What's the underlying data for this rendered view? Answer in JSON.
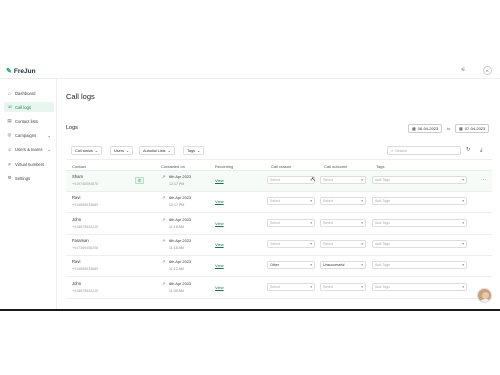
{
  "app": {
    "logo_text": "FreJun",
    "logo_mark": "✎"
  },
  "topbar": {
    "icons": [
      "filter-settings-icon",
      "settings-icon"
    ],
    "avatar_initial": "K"
  },
  "sidebar": {
    "items": [
      {
        "label": "Dashboard",
        "icon": "⌂",
        "active": false
      },
      {
        "label": "Call logs",
        "icon": "☏",
        "active": true
      },
      {
        "label": "Contact lists",
        "icon": "▤",
        "active": false
      },
      {
        "label": "Campaigns",
        "icon": "◎",
        "active": false,
        "has_caret": true
      },
      {
        "label": "Users & teams",
        "icon": "☺",
        "active": false,
        "has_caret": true
      },
      {
        "label": "Virtual numbers",
        "icon": "#",
        "active": false
      },
      {
        "label": "Settings",
        "icon": "⚙",
        "active": false
      }
    ]
  },
  "page": {
    "title": "Call logs",
    "section_title": "Logs"
  },
  "date_range": {
    "start": "06-04-2023",
    "to_label": "to",
    "end": "07-04-2023"
  },
  "filters": [
    {
      "label": "Call status"
    },
    {
      "label": "Users"
    },
    {
      "label": "Autodial Lists"
    },
    {
      "label": "Tags"
    }
  ],
  "search": {
    "placeholder": "Search"
  },
  "table": {
    "headers": [
      "Contact",
      "Contacted on",
      "Recording",
      "Call reason",
      "Call outcome",
      "Tags"
    ],
    "rows": [
      {
        "name": "Sham",
        "phone": "+919748094875",
        "date": "6th Apr 2023",
        "time": "12:17 PM",
        "recording": "View",
        "reason": "Select",
        "reason_filled": false,
        "outcome": "Select",
        "outcome_filled": false,
        "tags": "Add Tags",
        "highlight": true
      },
      {
        "name": "Ravi",
        "phone": "+919896533689",
        "date": "6th Apr 2023",
        "time": "12:17 PM",
        "recording": "View",
        "reason": "Select",
        "reason_filled": false,
        "outcome": "Select",
        "outcome_filled": false,
        "tags": "Add Tags",
        "highlight": false
      },
      {
        "name": "John",
        "phone": "+918879543210",
        "date": "6th Apr 2023",
        "time": "11:16 AM",
        "recording": "View",
        "reason": "Select",
        "reason_filled": false,
        "outcome": "Select",
        "outcome_filled": false,
        "tags": "Add Tags",
        "highlight": false
      },
      {
        "name": "Faraman",
        "phone": "+917349456208",
        "date": "6th Apr 2023",
        "time": "11:16 AM",
        "recording": "View",
        "reason": "Select",
        "reason_filled": false,
        "outcome": "Select",
        "outcome_filled": false,
        "tags": "Add Tags",
        "highlight": false
      },
      {
        "name": "Ravi",
        "phone": "+919896533689",
        "date": "6th Apr 2023",
        "time": "11:12 AM",
        "recording": "View",
        "reason": "Other",
        "reason_filled": true,
        "outcome": "Unsuccessful",
        "outcome_filled": true,
        "tags": "Add Tags",
        "highlight": false
      },
      {
        "name": "John",
        "phone": "+918879543210",
        "date": "6th Apr 2023",
        "time": "11:09 AM",
        "recording": "View",
        "reason": "Select",
        "reason_filled": false,
        "outcome": "Select",
        "outcome_filled": false,
        "tags": "Add Tags",
        "highlight": false
      }
    ]
  },
  "colors": {
    "accent": "#1d8a55",
    "highlight_row": "#f6fbf8"
  }
}
